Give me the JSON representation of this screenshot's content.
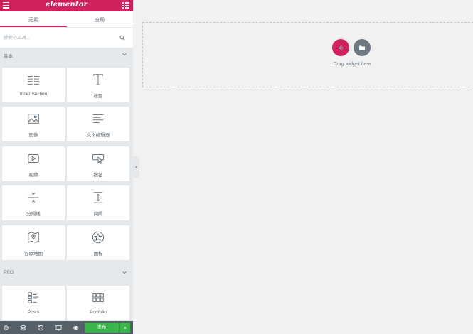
{
  "app": {
    "logo": "elementor"
  },
  "colors": {
    "brand": "#d0215f",
    "publish": "#39b54a",
    "panel_bg": "#e6e9ec",
    "bottom_bar": "#556068"
  },
  "tabs": [
    {
      "label": "元素",
      "active": true
    },
    {
      "label": "全局",
      "active": false
    }
  ],
  "search": {
    "placeholder": "搜索小工具..."
  },
  "categories": [
    {
      "label": "基本",
      "widgets": [
        {
          "label": "Inner Section",
          "icon": "inner-section-icon"
        },
        {
          "label": "标题",
          "icon": "heading-icon"
        },
        {
          "label": "图像",
          "icon": "image-icon"
        },
        {
          "label": "文本编辑器",
          "icon": "text-editor-icon"
        },
        {
          "label": "视频",
          "icon": "video-icon"
        },
        {
          "label": "按钮",
          "icon": "button-icon"
        },
        {
          "label": "分隔线",
          "icon": "divider-icon"
        },
        {
          "label": "间隔",
          "icon": "spacer-icon"
        },
        {
          "label": "谷歌地图",
          "icon": "google-maps-icon"
        },
        {
          "label": "图标",
          "icon": "star-icon"
        }
      ]
    },
    {
      "label": "PRO",
      "widgets": [
        {
          "label": "Posts",
          "icon": "posts-icon"
        },
        {
          "label": "Portfolio",
          "icon": "portfolio-icon"
        }
      ]
    }
  ],
  "bottom_bar": {
    "publish_label": "发布",
    "icons": [
      "settings-icon",
      "layers-icon",
      "history-icon",
      "responsive-icon",
      "preview-icon"
    ]
  },
  "canvas": {
    "drag_hint": "Drag widget here"
  }
}
